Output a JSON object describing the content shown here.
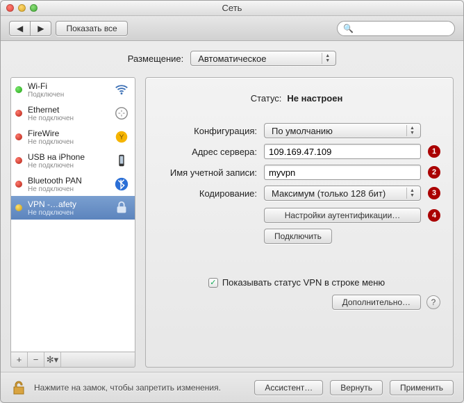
{
  "window": {
    "title": "Сеть"
  },
  "toolbar": {
    "back": "◀",
    "forward": "▶",
    "show_all": "Показать все",
    "search_placeholder": ""
  },
  "location": {
    "label": "Размещение:",
    "value": "Автоматическое"
  },
  "services": [
    {
      "name": "Wi-Fi",
      "status": "Подключен",
      "dot": "green",
      "icon": "wifi"
    },
    {
      "name": "Ethernet",
      "status": "Не подключен",
      "dot": "red",
      "icon": "ethernet"
    },
    {
      "name": "FireWire",
      "status": "Не подключен",
      "dot": "red",
      "icon": "firewire"
    },
    {
      "name": "USB на iPhone",
      "status": "Не подключен",
      "dot": "red",
      "icon": "iphone"
    },
    {
      "name": "Bluetooth PAN",
      "status": "Не подключен",
      "dot": "red",
      "icon": "bluetooth"
    },
    {
      "name": "VPN -…afety",
      "status": "Не подключен",
      "dot": "yellow",
      "icon": "vpn",
      "selected": true
    }
  ],
  "list_buttons": {
    "add": "+",
    "remove": "−",
    "gear": "✻▾"
  },
  "detail": {
    "status_label": "Статус:",
    "status_value": "Не настроен",
    "config_label": "Конфигурация:",
    "config_value": "По умолчанию",
    "server_label": "Адрес сервера:",
    "server_value": "109.169.47.109",
    "account_label": "Имя учетной записи:",
    "account_value": "myvpn",
    "encryption_label": "Кодирование:",
    "encryption_value": "Максимум (только 128 бит)",
    "auth_button": "Настройки аутентификации…",
    "connect_button": "Подключить",
    "show_status_checkbox": "Показывать статус VPN в строке меню",
    "show_status_checked": true,
    "advanced_button": "Дополнительно…",
    "help": "?",
    "badges": [
      "1",
      "2",
      "3",
      "4"
    ]
  },
  "footer": {
    "lock_hint": "Нажмите на замок, чтобы запретить изменения.",
    "assist": "Ассистент…",
    "revert": "Вернуть",
    "apply": "Применить"
  }
}
